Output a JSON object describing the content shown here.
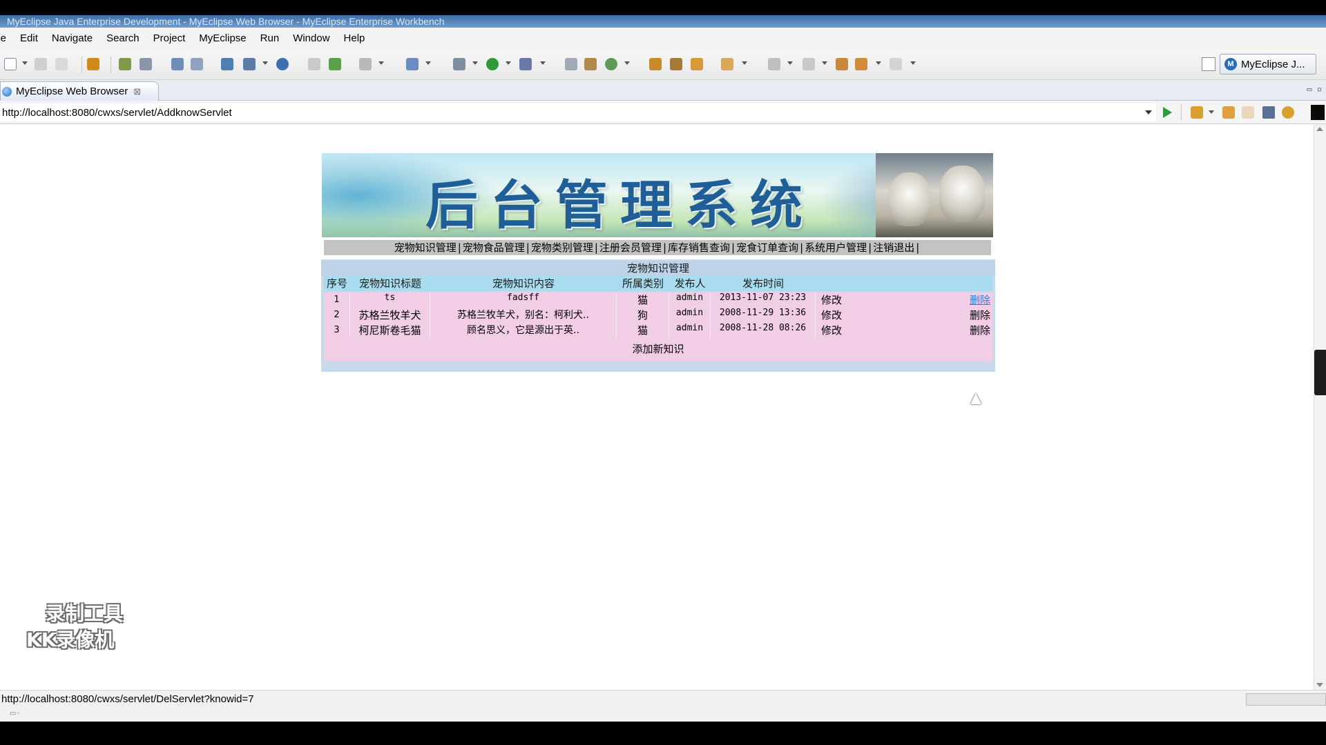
{
  "window": {
    "title": "MyEclipse Java Enterprise Development - MyEclipse Web Browser - MyEclipse Enterprise Workbench"
  },
  "menu": [
    "ile",
    "Edit",
    "Navigate",
    "Search",
    "Project",
    "MyEclipse",
    "Run",
    "Window",
    "Help"
  ],
  "toolbar": {
    "perspective_label": "MyEclipse J...",
    "perspective_logo": "M"
  },
  "editor_tab": {
    "label": "MyEclipse Web Browser",
    "close": "⊠"
  },
  "address": {
    "url": "http://localhost:8080/cwxs/servlet/AddknowServlet"
  },
  "page": {
    "banner_title": "后台管理系统",
    "nav": [
      "宠物知识管理",
      "宠物食品管理",
      "宠物类别管理",
      "注册会员管理",
      "库存销售查询",
      "宠食订单查询",
      "系统用户管理",
      "注销退出"
    ],
    "panel_title": "宠物知识管理",
    "columns": [
      "序号",
      "宠物知识标题",
      "宠物知识内容",
      "所属类别",
      "发布人",
      "发布时间"
    ],
    "rows": [
      {
        "no": "1",
        "title": "ts",
        "content": "fadsff",
        "category": "猫",
        "author": "admin",
        "time": "2013-11-07 23:23",
        "edit": "修改",
        "delete": "删除"
      },
      {
        "no": "2",
        "title": "苏格兰牧羊犬",
        "content": "苏格兰牧羊犬，别名：柯利犬..",
        "category": "狗",
        "author": "admin",
        "time": "2008-11-29 13:36",
        "edit": "修改",
        "delete": "删除"
      },
      {
        "no": "3",
        "title": "柯尼斯卷毛猫",
        "content": "顾名思义，它是源出于英..",
        "category": "猫",
        "author": "admin",
        "time": "2008-11-28 08:26",
        "edit": "修改",
        "delete": "删除"
      }
    ],
    "add_link": "添加新知识"
  },
  "watermark": {
    "line1": "录制工具",
    "line2": "KK录像机"
  },
  "status": {
    "text": "http://localhost:8080/cwxs/servlet/DelServlet?knowid=7"
  },
  "colors": {
    "accent": "#2a7fd8",
    "nav_bg": "#c3c3c3",
    "row_bg": "#f2cde6",
    "header_bg": "#a9dcef"
  }
}
